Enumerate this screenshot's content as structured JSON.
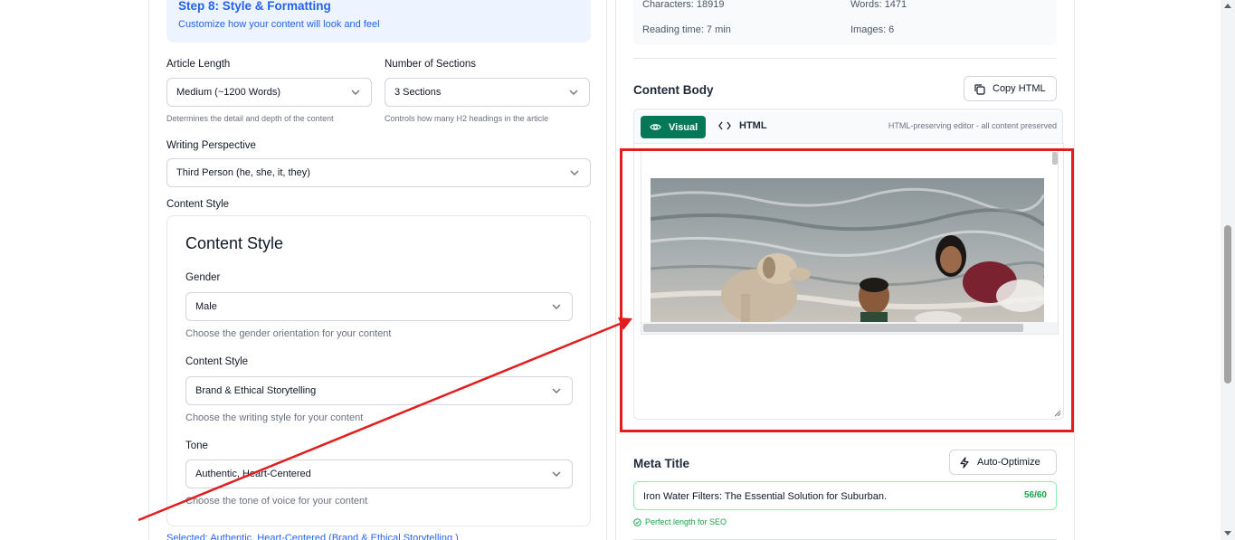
{
  "step": {
    "title": "Step 8: Style & Formatting",
    "subtitle": "Customize how your content will look and feel"
  },
  "form": {
    "article_length": {
      "label": "Article Length",
      "value": "Medium (~1200 Words)",
      "hint": "Determines the detail and depth of the content"
    },
    "sections": {
      "label": "Number of Sections",
      "value": "3 Sections",
      "hint": "Controls how many H2 headings in the article"
    },
    "perspective": {
      "label": "Writing Perspective",
      "value": "Third Person (he, she, it, they)"
    },
    "content_style_label": "Content Style"
  },
  "style_card": {
    "title": "Content Style",
    "gender": {
      "label": "Gender",
      "value": "Male",
      "hint": "Choose the gender orientation for your content"
    },
    "style": {
      "label": "Content Style",
      "value": "Brand & Ethical Storytelling",
      "hint": "Choose the writing style for your content"
    },
    "tone": {
      "label": "Tone",
      "value": "Authentic, Heart-Centered",
      "hint": "Choose the tone of voice for your content"
    }
  },
  "selected_text": "Selected: Authentic, Heart-Centered (Brand & Ethical Storytelling )",
  "stats": {
    "characters": "Characters: 18919",
    "words": "Words: 1471",
    "reading_time": "Reading time: 7 min",
    "images": "Images: 6"
  },
  "content_body": {
    "title": "Content Body",
    "copy_button": "Copy HTML",
    "tab_visual": "Visual",
    "tab_html": "HTML",
    "editor_note": "HTML-preserving editor - all content preserved"
  },
  "meta": {
    "title": "Meta Title",
    "auto_button": "Auto-Optimize",
    "value": "Iron Water Filters: The Essential Solution for Suburban.",
    "count": "56/60",
    "status": "Perfect length for SEO"
  },
  "colors": {
    "accent_blue": "#2563eb",
    "green": "#047857",
    "highlight_red": "#e11d1d"
  }
}
